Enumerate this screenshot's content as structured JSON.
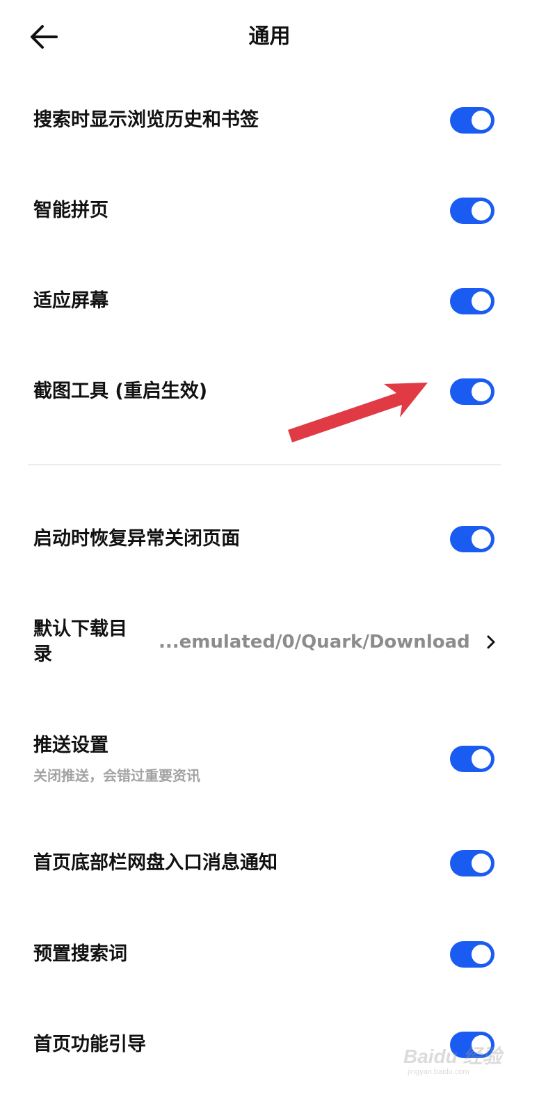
{
  "header": {
    "back_icon": "arrow-left-icon",
    "title": "通用"
  },
  "settings_group_1": [
    {
      "label": "搜索时显示浏览历史和书签",
      "enabled": true
    },
    {
      "label": "智能拼页",
      "enabled": true
    },
    {
      "label": "适应屏幕",
      "enabled": true
    },
    {
      "label": "截图工具 (重启生效)",
      "enabled": true
    }
  ],
  "settings_group_2": {
    "restore_pages": {
      "label": "启动时恢复异常关闭页面",
      "enabled": true
    },
    "download_dir": {
      "label": "默认下载目录",
      "value": "...emulated/0/Quark/Download",
      "chevron_icon": "chevron-right-icon"
    },
    "push": {
      "label": "推送设置",
      "sublabel": "关闭推送，会错过重要资讯",
      "enabled": true
    },
    "netdisk_notify": {
      "label": "首页底部栏网盘入口消息通知",
      "enabled": true
    },
    "preset_search": {
      "label": "预置搜索词",
      "enabled": true
    },
    "home_guide": {
      "label": "首页功能引导",
      "enabled": true
    }
  },
  "colors": {
    "toggle_on": "#1a5cf2",
    "annotation_arrow": "#e03a45",
    "text_primary": "#111111",
    "text_secondary": "#a3a3a3"
  },
  "watermark": {
    "brand": "Baidu 经验",
    "url": "jingyan.baidu.com"
  }
}
